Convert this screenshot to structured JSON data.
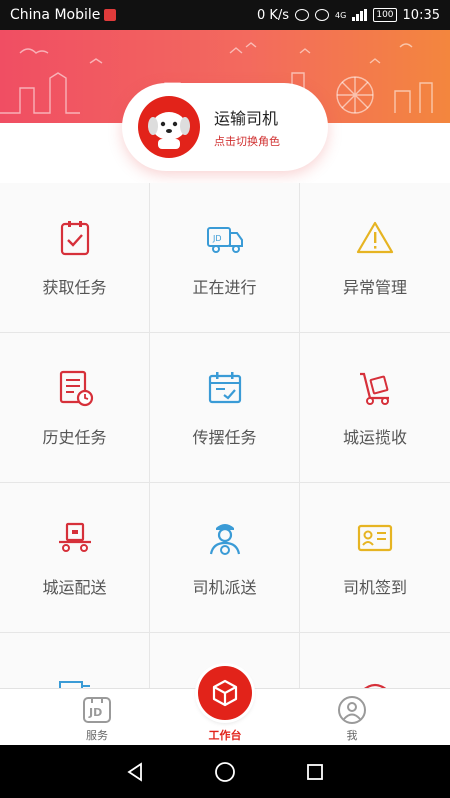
{
  "status_bar": {
    "carrier": "China Mobile",
    "speed": "0 K/s",
    "network": "4G",
    "battery": "100",
    "time": "10:35"
  },
  "role_card": {
    "title": "运输司机",
    "subtitle": "点击切换角色"
  },
  "grid_items": [
    {
      "label": "获取任务",
      "icon": "clipboard-check-icon"
    },
    {
      "label": "正在进行",
      "icon": "delivery-truck-icon"
    },
    {
      "label": "异常管理",
      "icon": "warning-icon"
    },
    {
      "label": "历史任务",
      "icon": "history-document-icon"
    },
    {
      "label": "传摆任务",
      "icon": "calendar-check-icon"
    },
    {
      "label": "城运揽收",
      "icon": "hand-truck-icon"
    },
    {
      "label": "城运配送",
      "icon": "delivery-cart-icon"
    },
    {
      "label": "司机派送",
      "icon": "driver-icon"
    },
    {
      "label": "司机签到",
      "icon": "id-card-icon"
    }
  ],
  "bottom_nav": [
    {
      "label": "服务",
      "icon": "jd-service-icon"
    },
    {
      "label": "工作台",
      "icon": "package-icon"
    },
    {
      "label": "我",
      "icon": "profile-icon"
    }
  ],
  "colors": {
    "accent": "#e2231a",
    "blue": "#3a9bd6",
    "yellow": "#e6b422"
  }
}
